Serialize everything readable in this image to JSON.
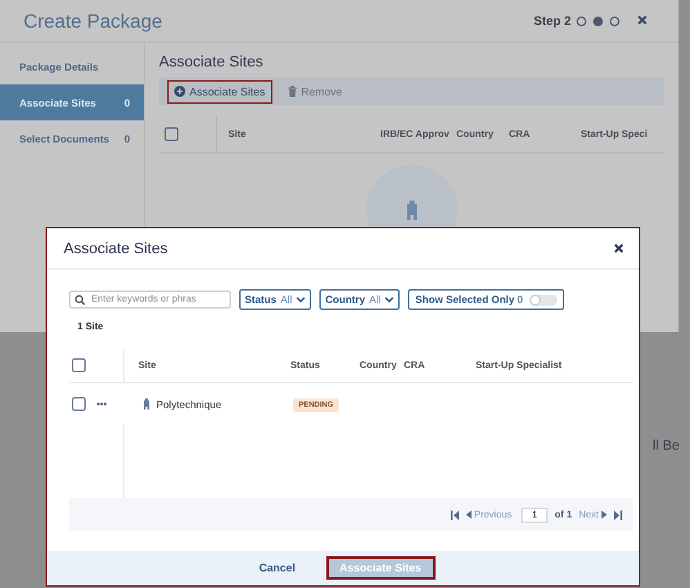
{
  "background_dialog": {
    "title": "Create Package",
    "step_label": "Step 2",
    "steps": [
      {
        "selected": false
      },
      {
        "selected": true
      },
      {
        "selected": false
      }
    ],
    "sidebar": {
      "items": [
        {
          "label": "Package Details",
          "selected": false
        },
        {
          "label": "Associate Sites",
          "count": "0",
          "selected": true
        },
        {
          "label": "Select Documents",
          "count": "0",
          "selected": false
        }
      ]
    },
    "section_title": "Associate Sites",
    "toolbar": [
      {
        "label": "Associate Sites",
        "kind": "add",
        "disabled": false
      },
      {
        "label": "Remove",
        "kind": "remove",
        "disabled": true
      }
    ],
    "table": {
      "select_all_checked": false,
      "columns": [
        "Site",
        "IRB/EC Approv",
        "Country",
        "CRA",
        "Start-Up Speci"
      ]
    }
  },
  "backdrop_text": "ll Be",
  "modal": {
    "title": "Associate Sites",
    "search": {
      "placeholder": "Enter keywords or phras"
    },
    "filters": [
      {
        "label": "Status",
        "value": "All"
      },
      {
        "label": "Country",
        "value": "All"
      }
    ],
    "show_selected": {
      "label": "Show Selected Only",
      "count": "0",
      "on": false
    },
    "result_count": "1 Site",
    "table": {
      "select_all_checked": false,
      "columns": [
        "Site",
        "Status",
        "Country",
        "CRA",
        "Start-Up Specialist"
      ],
      "rows": [
        {
          "checked": false,
          "site": "Polytechnique",
          "status": "PENDING"
        }
      ]
    },
    "pagination": {
      "previous": "Previous",
      "page": "1",
      "of": "of 1",
      "next": "Next"
    },
    "footer": {
      "cancel": "Cancel",
      "confirm": "Associate Sites",
      "confirm_disabled": true
    }
  }
}
